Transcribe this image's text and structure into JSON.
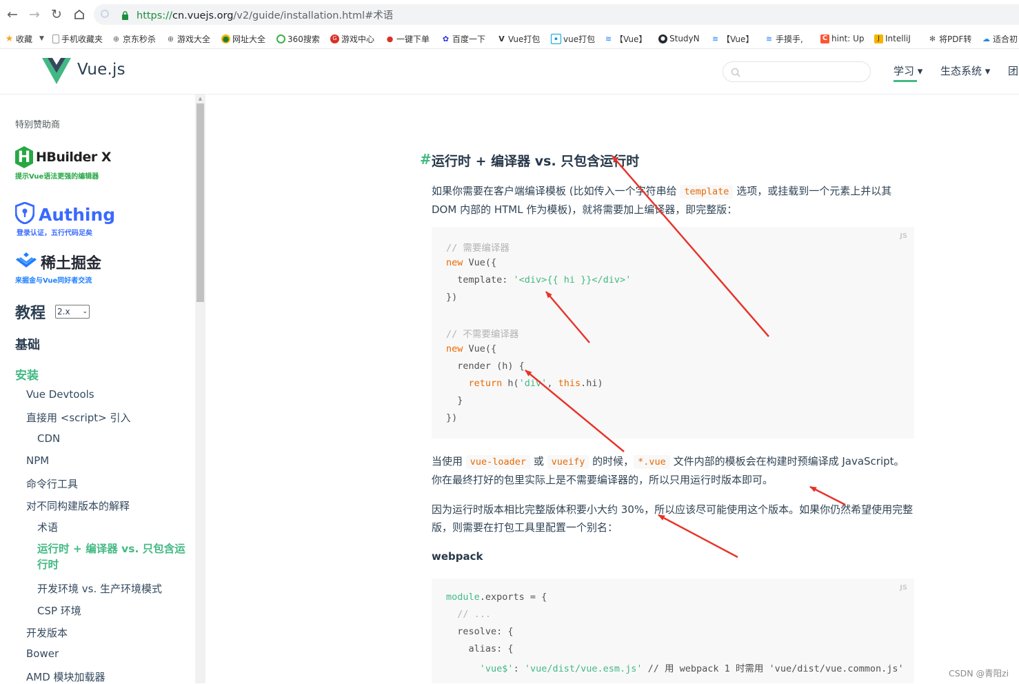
{
  "browser": {
    "url": {
      "protocol": "https://",
      "host": "cn.vuejs.org",
      "path": "/v2/guide/installation.html#术语"
    },
    "bookmarks": [
      "收藏",
      "手机收藏夹",
      "京东秒杀",
      "游戏大全",
      "网址大全",
      "360搜索",
      "游戏中心",
      "一键下单",
      "百度一下",
      "Vue打包",
      "vue打包",
      "【Vue】",
      "StudyN",
      "【Vue】",
      "手摸手,",
      "hint: Up",
      "IntelliJ",
      "将PDF转",
      "适合初"
    ]
  },
  "site": {
    "logo_text": "Vue.js",
    "nav": {
      "learn": "学习 ▾",
      "ecosystem": "生态系统 ▾",
      "team": "团"
    }
  },
  "sidebar": {
    "sponsor_title": "特别赞助商",
    "sponsors": [
      {
        "name": "HBuilder X",
        "tagline": "提示Vue语法更强的编辑器",
        "color": "#28a745"
      },
      {
        "name": "Authing",
        "tagline": "登录认证，五行代码足矣",
        "color": "#396aff"
      },
      {
        "name": "稀土掘金",
        "tagline": "来掘金与Vue同好者交流",
        "color": "#1e80ff"
      }
    ],
    "tutorial_heading": "教程",
    "version_selected": "2.x",
    "basics_heading": "基础",
    "install_heading": "安装",
    "links": {
      "devtools": "Vue Devtools",
      "script": "直接用 <script> 引入",
      "cdn": "CDN",
      "npm": "NPM",
      "cli": "命令行工具",
      "builds": "对不同构建版本的解释",
      "terms": "术语",
      "runtime": "运行时 + 编译器 vs. 只包含运行时",
      "devprod": "开发环境 vs. 生产环境模式",
      "csp": "CSP 环境",
      "dev": "开发版本",
      "bower": "Bower",
      "amd": "AMD 模块加载器"
    }
  },
  "content": {
    "anchor": "#",
    "heading": "运行时 + 编译器 vs. 只包含运行时",
    "p1": {
      "a": "如果你需要在客户端编译模板 (比如传入一个字符串给 ",
      "code": "template",
      "b": " 选项，或挂载到一个元素上并以其 DOM 内部的 HTML 作为模板)，就将需要加上编译器，即完整版："
    },
    "code1": {
      "lang": "JS",
      "c1": "// 需要编译器",
      "new1_kw": "new",
      "new1_rest": " Vue({",
      "tpl_key": "  template: ",
      "tpl_val": "'<div>{{ hi }}</div>'",
      "close1": "})",
      "c2": "// 不需要编译器",
      "new2_kw": "new",
      "new2_rest": " Vue({",
      "render": "  render (h) {",
      "ret_kw": "    return",
      "ret_mid": " h(",
      "ret_str": "'div'",
      "ret_comma": ", ",
      "ret_this": "this",
      "ret_end": ".hi)",
      "brace": "  }",
      "close2": "})"
    },
    "p2": {
      "a": "当使用 ",
      "code1": "vue-loader",
      "b": " 或 ",
      "code2": "vueify",
      "c": " 的时候，",
      "code3": "*.vue",
      "d": " 文件内部的模板会在构建时预编译成 JavaScript。你在最终打好的包里实际上是不需要编译器的，所以只用运行时版本即可。"
    },
    "p3": "因为运行时版本相比完整版体积要小大约 30%，所以应该尽可能使用这个版本。如果你仍然希望使用完整版，则需要在打包工具里配置一个别名：",
    "webpack_label": "webpack",
    "code2": {
      "lang": "JS",
      "l1_a": "module",
      "l1_b": ".exports = {",
      "l2": "  // ...",
      "l3": "  resolve: {",
      "l4": "    alias: {",
      "l5_indent": "      ",
      "l5_key": "'vue$'",
      "l5_colon": ": ",
      "l5_val": "'vue/dist/vue.esm.js'",
      "l5_cm": " // 用 webpack 1 时需用 'vue/dist/vue.common.js'"
    }
  },
  "watermark": "CSDN @青阳zi",
  "annotation_color": "#e8332a"
}
